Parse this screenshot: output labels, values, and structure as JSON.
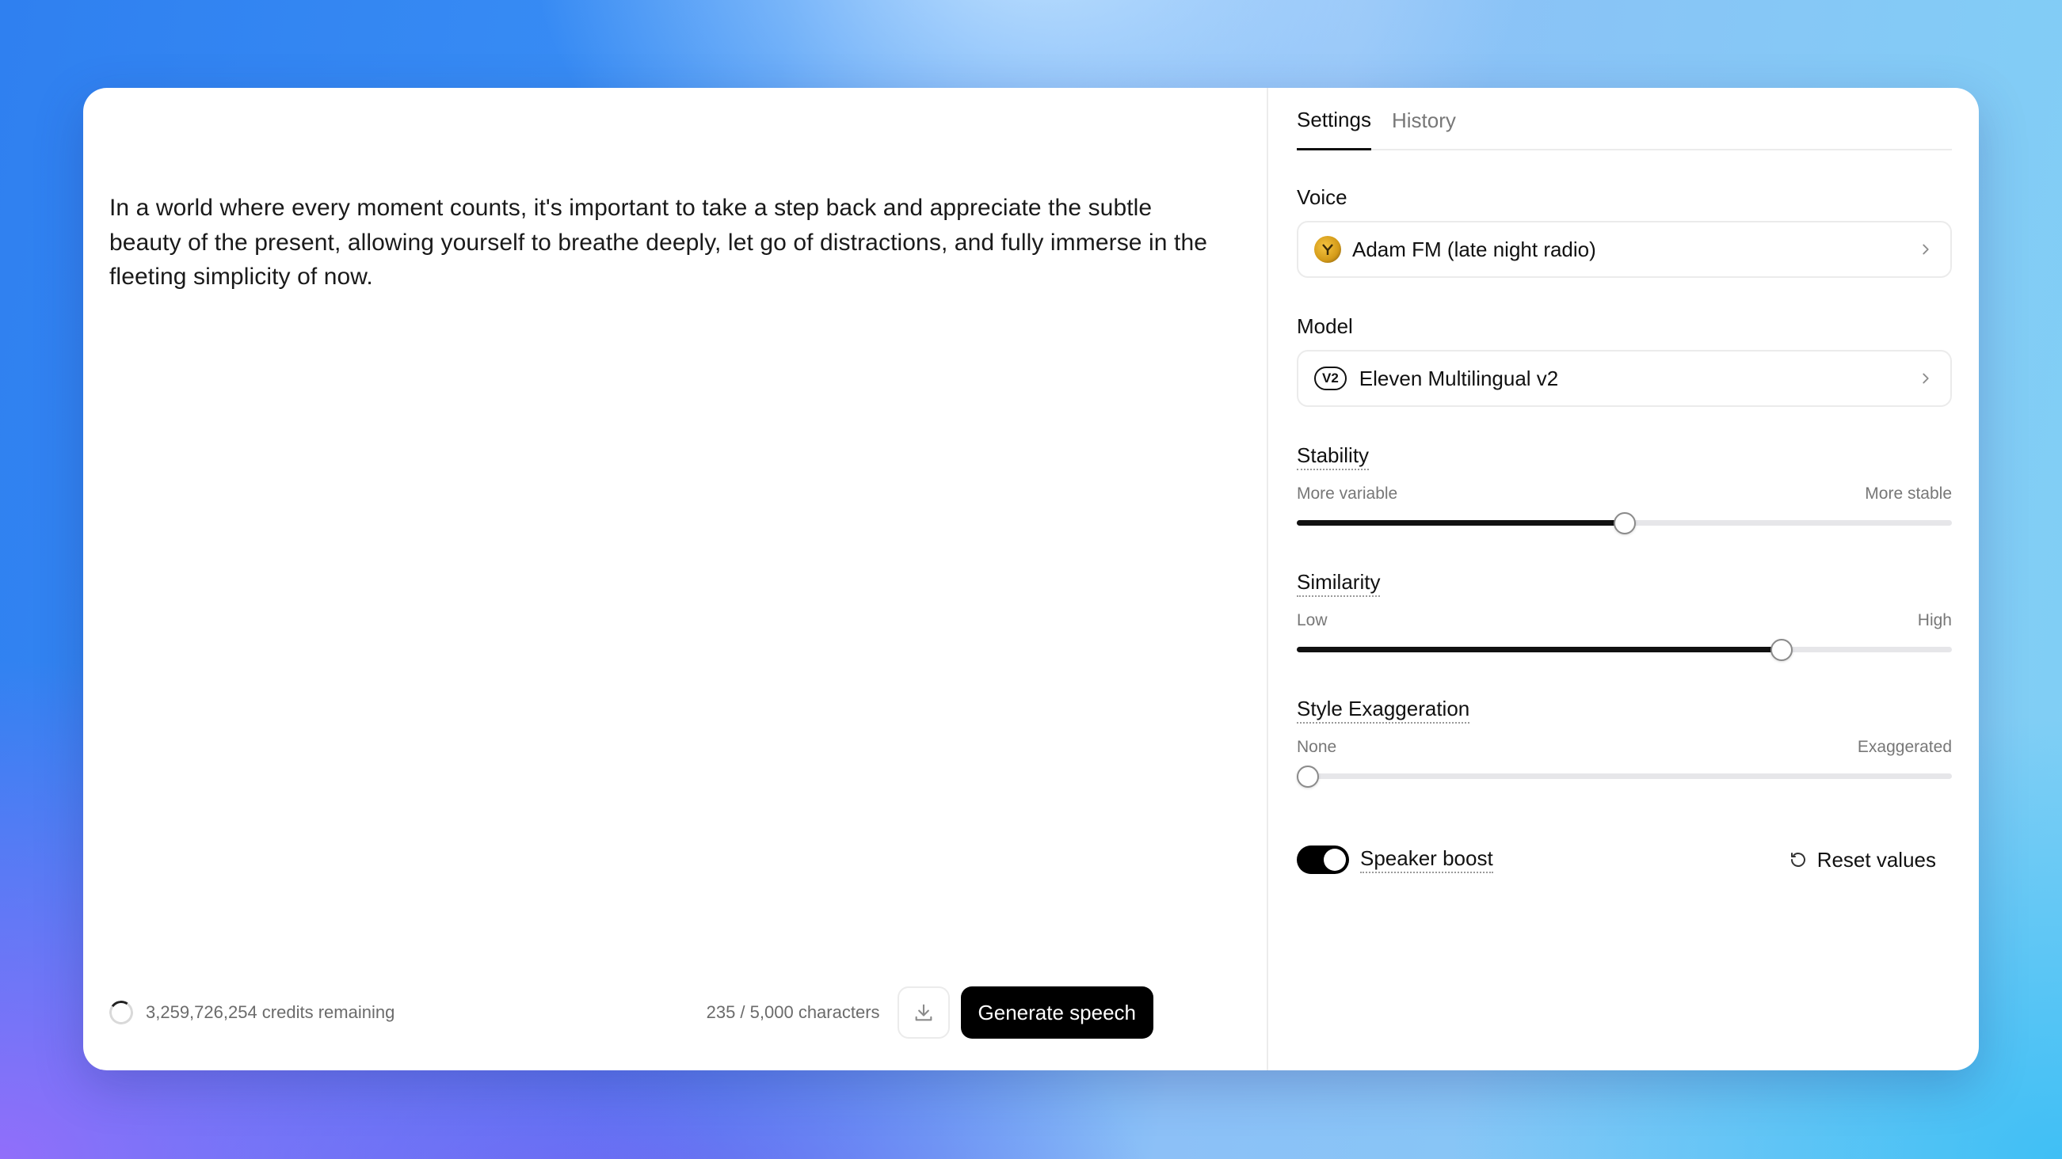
{
  "editor": {
    "text": "In a world where every moment counts, it's important to take a step back and appreciate the subtle beauty of the present, allowing yourself to breathe deeply, let go of distractions, and fully immerse in the fleeting simplicity of now.",
    "credits": "3,259,726,254 credits remaining",
    "char_count": "235 / 5,000 characters",
    "generate_label": "Generate speech"
  },
  "tabs": [
    {
      "label": "Settings",
      "active": true
    },
    {
      "label": "History",
      "active": false
    }
  ],
  "voice": {
    "label": "Voice",
    "value": "Adam FM (late night radio)"
  },
  "model": {
    "label": "Model",
    "badge": "V2",
    "value": "Eleven Multilingual v2"
  },
  "sliders": [
    {
      "label": "Stability",
      "min_label": "More variable",
      "max_label": "More stable",
      "value": 0.5
    },
    {
      "label": "Similarity",
      "min_label": "Low",
      "max_label": "High",
      "value": 0.74
    },
    {
      "label": "Style Exaggeration",
      "min_label": "None",
      "max_label": "Exaggerated",
      "value": 0.0
    }
  ],
  "speaker_boost": {
    "label": "Speaker boost",
    "enabled": true
  },
  "reset_label": "Reset values",
  "icons": {
    "download": "download-icon",
    "chevron": "chevron-right-icon",
    "reset": "reset-icon"
  }
}
